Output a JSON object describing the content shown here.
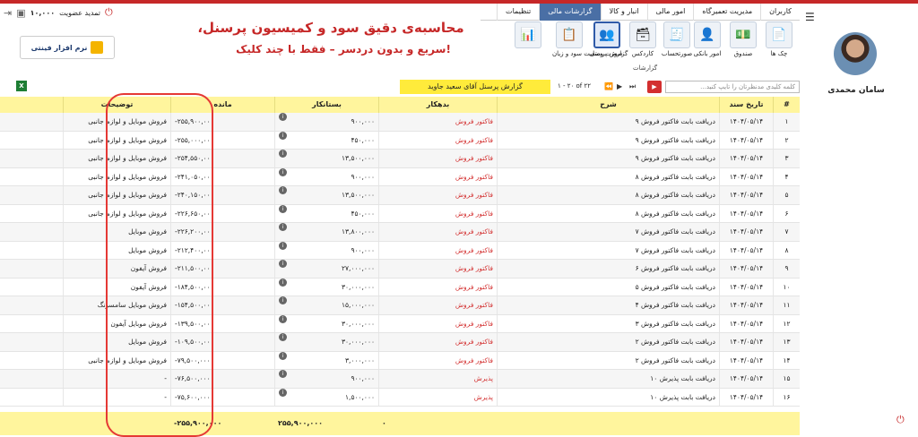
{
  "header": {
    "balance": "۱۰,۰۰۰",
    "renew_label": "تمدید عضویت"
  },
  "tabs": [
    {
      "label": "کاربران"
    },
    {
      "label": "مدیریت تعمیرگاه"
    },
    {
      "label": "امور مالی"
    },
    {
      "label": "انبار و کالا"
    },
    {
      "label": "گزارشات مالی",
      "active": true
    },
    {
      "label": "تنظیمات"
    }
  ],
  "ribbon": {
    "buttons": [
      {
        "label": "چک ها",
        "icon": "check-icon"
      },
      {
        "label": "صندوق",
        "icon": "cashbox-icon"
      },
      {
        "label": "امور بانکی",
        "icon": "bank-icon"
      },
      {
        "label": "صورتحساب",
        "icon": "invoice-icon"
      },
      {
        "label": "کاردکس",
        "icon": "cardex-icon"
      },
      {
        "label": "گزارش پرسنل",
        "icon": "personnel-icon",
        "selected": true
      },
      {
        "label": "صورت وضعیت سود و زیان",
        "icon": "profit-loss-icon"
      },
      {
        "label": "",
        "icon": "extra-icon"
      }
    ],
    "group_label": "گزارشات"
  },
  "promo": {
    "line1": "محاسبه‌ی دقیق سود و کمیسیون پرسنل،",
    "line2": "!سریع و بدون دردسر – فقط با چند کلیک"
  },
  "logo_text": "نرم افزار فینتی",
  "user": {
    "name": "سامان محمدی"
  },
  "toolbar": {
    "search_placeholder": "کلمه کلیدی مدنظرتان را تایپ کنید...",
    "pager": "۱ - ۲۰ of ۲۲",
    "report_title": "گزارش پرسنل آقای سعید جاوید"
  },
  "table": {
    "headers": {
      "num": "#",
      "date": "تاریخ سند",
      "desc": "شرح",
      "debit": "بدهکار",
      "credit": "بستانکار",
      "balance": "مانده",
      "notes": "توضیحات"
    },
    "rows": [
      {
        "num": "۱",
        "date": "۱۴۰۴/۰۵/۱۴",
        "desc": "دریافت بابت فاکتور فروش ۹",
        "debit": "فاکتور فروش",
        "credit": "۹۰۰,۰۰۰",
        "balance": "-۲۵۵,۹۰۰,۰۰۰",
        "notes": "فروش موبایل و لوازم جانبی"
      },
      {
        "num": "۲",
        "date": "۱۴۰۴/۰۵/۱۴",
        "desc": "دریافت بابت فاکتور فروش ۹",
        "debit": "فاکتور فروش",
        "credit": "۴۵۰,۰۰۰",
        "balance": "-۲۵۵,۰۰۰,۰۰۰",
        "notes": "فروش موبایل و لوازم جانبی"
      },
      {
        "num": "۳",
        "date": "۱۴۰۴/۰۵/۱۴",
        "desc": "دریافت بابت فاکتور فروش ۹",
        "debit": "فاکتور فروش",
        "credit": "۱۳,۵۰۰,۰۰۰",
        "balance": "-۲۵۴,۵۵۰,۰۰۰",
        "notes": "فروش موبایل و لوازم جانبی"
      },
      {
        "num": "۴",
        "date": "۱۴۰۴/۰۵/۱۴",
        "desc": "دریافت بابت فاکتور فروش ۸",
        "debit": "فاکتور فروش",
        "credit": "۹۰۰,۰۰۰",
        "balance": "-۲۴۱,۰۵۰,۰۰۰",
        "notes": "فروش موبایل و لوازم جانبی"
      },
      {
        "num": "۵",
        "date": "۱۴۰۴/۰۵/۱۴",
        "desc": "دریافت بابت فاکتور فروش ۸",
        "debit": "فاکتور فروش",
        "credit": "۱۳,۵۰۰,۰۰۰",
        "balance": "-۲۴۰,۱۵۰,۰۰۰",
        "notes": "فروش موبایل و لوازم جانبی"
      },
      {
        "num": "۶",
        "date": "۱۴۰۴/۰۵/۱۴",
        "desc": "دریافت بابت فاکتور فروش ۸",
        "debit": "فاکتور فروش",
        "credit": "۴۵۰,۰۰۰",
        "balance": "-۲۲۶,۶۵۰,۰۰۰",
        "notes": "فروش موبایل و لوازم جانبی"
      },
      {
        "num": "۷",
        "date": "۱۴۰۴/۰۵/۱۴",
        "desc": "دریافت بابت فاکتور فروش ۷",
        "debit": "فاکتور فروش",
        "credit": "۱۳,۸۰۰,۰۰۰",
        "balance": "-۲۲۶,۲۰۰,۰۰۰",
        "notes": "فروش موبایل"
      },
      {
        "num": "۸",
        "date": "۱۴۰۴/۰۵/۱۴",
        "desc": "دریافت بابت فاکتور فروش ۷",
        "debit": "فاکتور فروش",
        "credit": "۹۰۰,۰۰۰",
        "balance": "-۲۱۲,۴۰۰,۰۰۰",
        "notes": "فروش موبایل"
      },
      {
        "num": "۹",
        "date": "۱۴۰۴/۰۵/۱۴",
        "desc": "دریافت بابت فاکتور فروش ۶",
        "debit": "فاکتور فروش",
        "credit": "۲۷,۰۰۰,۰۰۰",
        "balance": "-۲۱۱,۵۰۰,۰۰۰",
        "notes": "فروش آیفون"
      },
      {
        "num": "۱۰",
        "date": "۱۴۰۴/۰۵/۱۴",
        "desc": "دریافت بابت فاکتور فروش ۵",
        "debit": "فاکتور فروش",
        "credit": "۳۰,۰۰۰,۰۰۰",
        "balance": "-۱۸۴,۵۰۰,۰۰۰",
        "notes": "فروش آیفون"
      },
      {
        "num": "۱۱",
        "date": "۱۴۰۴/۰۵/۱۴",
        "desc": "دریافت بابت فاکتور فروش ۴",
        "debit": "فاکتور فروش",
        "credit": "۱۵,۰۰۰,۰۰۰",
        "balance": "-۱۵۴,۵۰۰,۰۰۰",
        "notes": "فروش موبایل سامسونگ"
      },
      {
        "num": "۱۲",
        "date": "۱۴۰۴/۰۵/۱۴",
        "desc": "دریافت بابت فاکتور فروش ۳",
        "debit": "فاکتور فروش",
        "credit": "۳۰,۰۰۰,۰۰۰",
        "balance": "-۱۳۹,۵۰۰,۰۰۰",
        "notes": "فروش موبایل آیفون"
      },
      {
        "num": "۱۳",
        "date": "۱۴۰۴/۰۵/۱۴",
        "desc": "دریافت بابت فاکتور فروش ۲",
        "debit": "فاکتور فروش",
        "credit": "۳۰,۰۰۰,۰۰۰",
        "balance": "-۱۰۹,۵۰۰,۰۰۰",
        "notes": "فروش موبایل"
      },
      {
        "num": "۱۴",
        "date": "۱۴۰۴/۰۵/۱۴",
        "desc": "دریافت بابت فاکتور فروش ۲",
        "debit": "فاکتور فروش",
        "credit": "۳,۰۰۰,۰۰۰",
        "balance": "-۷۹,۵۰۰,۰۰۰",
        "notes": "فروش موبایل و لوازم جانبی"
      },
      {
        "num": "۱۵",
        "date": "۱۴۰۴/۰۵/۱۴",
        "desc": "دریافت بابت پذیرش ۱۰",
        "debit": "پذیرش",
        "credit": "۹۰۰,۰۰۰",
        "balance": "-۷۶,۵۰۰,۰۰۰",
        "notes": "-"
      },
      {
        "num": "۱۶",
        "date": "۱۴۰۴/۰۵/۱۴",
        "desc": "دریافت بابت پذیرش ۱۰",
        "debit": "پذیرش",
        "credit": "۱,۵۰۰,۰۰۰",
        "balance": "-۷۵,۶۰۰,۰۰۰",
        "notes": "-"
      }
    ],
    "footer": {
      "debit_total": "۰",
      "credit_total": "۲۵۵,۹۰۰,۰۰۰",
      "balance_total": "-۲۵۵,۹۰۰,۰۰۰"
    }
  }
}
